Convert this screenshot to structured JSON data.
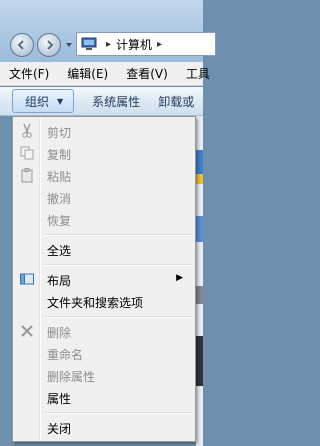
{
  "address": {
    "path": "计算机",
    "chevron": "▸"
  },
  "menubar": [
    {
      "label": "文件(F)"
    },
    {
      "label": "编辑(E)"
    },
    {
      "label": "查看(V)"
    },
    {
      "label": "工具"
    }
  ],
  "commandbar": {
    "organize": "组织",
    "organize_arrow": "▼",
    "system_properties": "系统属性",
    "uninstall": "卸载或"
  },
  "menu": {
    "cut": "剪切",
    "copy": "复制",
    "paste": "粘贴",
    "undo": "撤消",
    "redo": "恢复",
    "select_all": "全选",
    "layout": "布局",
    "layout_submenu_arrow": "▶",
    "folder_options": "文件夹和搜索选项",
    "delete": "删除",
    "rename": "重命名",
    "remove_properties": "删除属性",
    "properties": "属性",
    "close": "关闭"
  }
}
